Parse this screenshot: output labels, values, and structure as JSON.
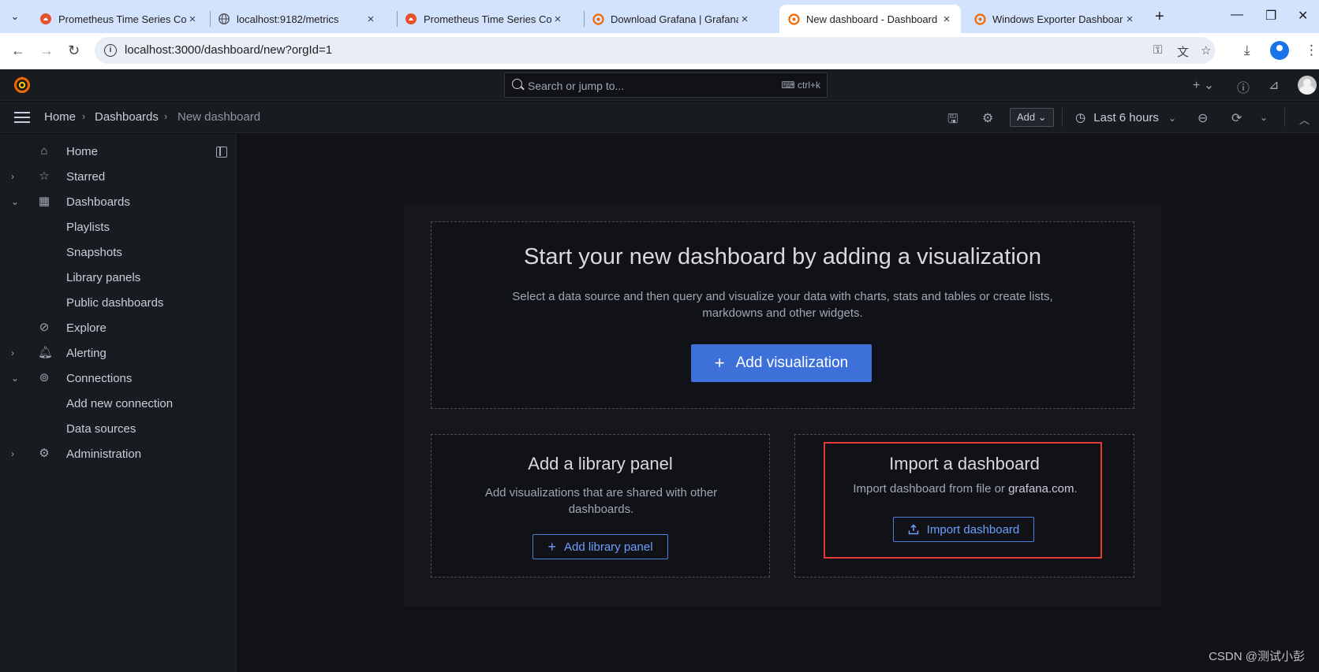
{
  "browser": {
    "tabs": [
      {
        "title": "Prometheus Time Series Coll",
        "icon": "prometheus-icon",
        "active": false
      },
      {
        "title": "localhost:9182/metrics",
        "icon": "globe-icon",
        "active": false
      },
      {
        "title": "Prometheus Time Series Coll",
        "icon": "prometheus-icon",
        "active": false
      },
      {
        "title": "Download Grafana | Grafana",
        "icon": "grafana-icon",
        "active": false
      },
      {
        "title": "New dashboard - Dashboard",
        "icon": "grafana-icon",
        "active": true
      },
      {
        "title": "Windows Exporter Dashboar",
        "icon": "grafana-icon",
        "active": false
      }
    ],
    "url": "localhost:3000/dashboard/new?orgId=1"
  },
  "grafana": {
    "search_placeholder": "Search or jump to...",
    "search_shortcut": "ctrl+k",
    "breadcrumbs": [
      "Home",
      "Dashboards",
      "New dashboard"
    ],
    "add_label": "Add",
    "time_range": "Last 6 hours"
  },
  "sidebar": {
    "items": [
      {
        "label": "Home",
        "icon": "home-icon",
        "chevron": ""
      },
      {
        "label": "Starred",
        "icon": "star-icon",
        "chevron": "right"
      },
      {
        "label": "Dashboards",
        "icon": "dashboards-icon",
        "chevron": "down"
      },
      {
        "label": "Playlists",
        "icon": "",
        "chevron": ""
      },
      {
        "label": "Snapshots",
        "icon": "",
        "chevron": ""
      },
      {
        "label": "Library panels",
        "icon": "",
        "chevron": ""
      },
      {
        "label": "Public dashboards",
        "icon": "",
        "chevron": ""
      },
      {
        "label": "Explore",
        "icon": "compass-icon",
        "chevron": ""
      },
      {
        "label": "Alerting",
        "icon": "bell-icon",
        "chevron": "right"
      },
      {
        "label": "Connections",
        "icon": "connections-icon",
        "chevron": "down"
      },
      {
        "label": "Add new connection",
        "icon": "",
        "chevron": ""
      },
      {
        "label": "Data sources",
        "icon": "",
        "chevron": ""
      },
      {
        "label": "Administration",
        "icon": "gear-icon",
        "chevron": "right"
      }
    ]
  },
  "empty_state": {
    "title": "Start your new dashboard by adding a visualization",
    "description": "Select a data source and then query and visualize your data with charts, stats and tables or create lists, markdowns and other widgets.",
    "add_visualization": "Add visualization",
    "library_title": "Add a library panel",
    "library_desc": "Add visualizations that are shared with other dashboards.",
    "library_button": "Add library panel",
    "import_title": "Import a dashboard",
    "import_desc_prefix": "Import dashboard from file or",
    "import_desc_link": "grafana.com",
    "import_desc_suffix": ".",
    "import_button": "Import dashboard"
  },
  "watermark": "CSDN @测试小彭",
  "colors": {
    "primary": "#3d71d9",
    "highlight": "#e53935",
    "grafana_orange": "#f46800"
  }
}
